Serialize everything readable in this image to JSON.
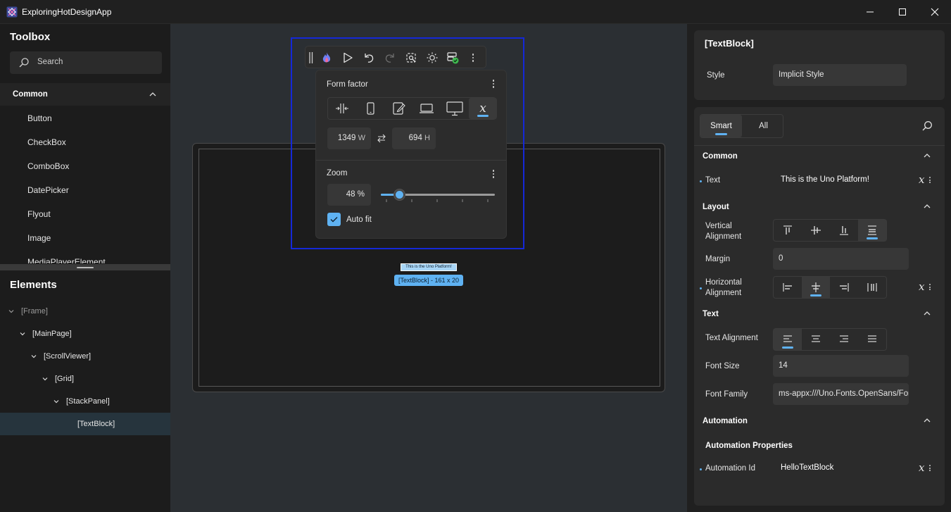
{
  "window": {
    "title": "ExploringHotDesignApp"
  },
  "toolbox": {
    "title": "Toolbox",
    "search_placeholder": "Search",
    "category": "Common",
    "items": [
      "Button",
      "CheckBox",
      "ComboBox",
      "DatePicker",
      "Flyout",
      "Image",
      "MediaPlayerElement"
    ]
  },
  "elements": {
    "title": "Elements",
    "tree": [
      {
        "label": "[Frame]",
        "depth": 0
      },
      {
        "label": "[MainPage]",
        "depth": 1
      },
      {
        "label": "[ScrollViewer]",
        "depth": 2
      },
      {
        "label": "[Grid]",
        "depth": 3
      },
      {
        "label": "[StackPanel]",
        "depth": 4
      },
      {
        "label": "[TextBlock]",
        "depth": 5,
        "selected": true
      }
    ]
  },
  "popup": {
    "form_factor_label": "Form factor",
    "width_value": "1349",
    "width_unit": "W",
    "height_value": "694",
    "height_unit": "H",
    "zoom_label": "Zoom",
    "zoom_value": "48 %",
    "zoom_fraction": 0.13,
    "autofit_label": "Auto fit",
    "autofit_checked": true
  },
  "design_canvas": {
    "text": "This is the Uno Platform!",
    "selection_badge": "[TextBlock] - 161 x 20"
  },
  "properties": {
    "element_title": "[TextBlock]",
    "style_label": "Style",
    "style_value": "Implicit Style",
    "tabs": [
      "Smart",
      "All"
    ],
    "active_tab": "Smart",
    "sections": {
      "common": "Common",
      "layout": "Layout",
      "text": "Text",
      "automation": "Automation"
    },
    "text_label": "Text",
    "text_value": "This is the Uno Platform!",
    "vertical_alignment_label": "Vertical Alignment",
    "margin_label": "Margin",
    "margin_value": "0",
    "horizontal_alignment_label": "Horizontal Alignment",
    "text_alignment_label": "Text Alignment",
    "font_size_label": "Font Size",
    "font_size_value": "14",
    "font_family_label": "Font Family",
    "font_family_value": "ms-appx:///Uno.Fonts.OpenSans/Fonts/OpenSans.ttf",
    "automation_properties_label": "Automation Properties",
    "automation_id_label": "Automation Id",
    "automation_id_value": "HelloTextBlock"
  },
  "colors": {
    "accent": "#5fb2f2",
    "selection_outline": "#1428d8"
  }
}
